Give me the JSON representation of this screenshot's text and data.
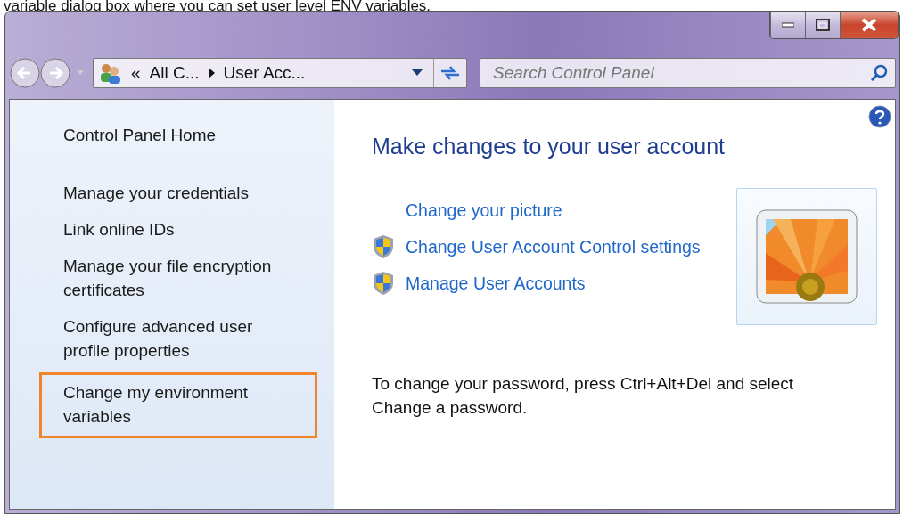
{
  "caption": "variable dialog box where you can set user level ENV variables.",
  "address_bar": {
    "overflow": "«",
    "crumbs": [
      "All C...",
      "User Acc..."
    ]
  },
  "search": {
    "placeholder": "Search Control Panel"
  },
  "sidebar": {
    "home": "Control Panel Home",
    "items": [
      {
        "label": "Manage your credentials",
        "highlighted": false
      },
      {
        "label": "Link online IDs",
        "highlighted": false
      },
      {
        "label": "Manage your file encryption certificates",
        "highlighted": false
      },
      {
        "label": "Configure advanced user profile properties",
        "highlighted": false
      },
      {
        "label": "Change my environment variables",
        "highlighted": true
      }
    ]
  },
  "main": {
    "heading": "Make changes to your user account",
    "links": [
      {
        "label": "Change your picture",
        "shield": false
      },
      {
        "label": "Change User Account Control settings",
        "shield": true
      },
      {
        "label": "Manage User Accounts",
        "shield": true
      }
    ],
    "note": "To change your password, press Ctrl+Alt+Del and select Change a password."
  }
}
